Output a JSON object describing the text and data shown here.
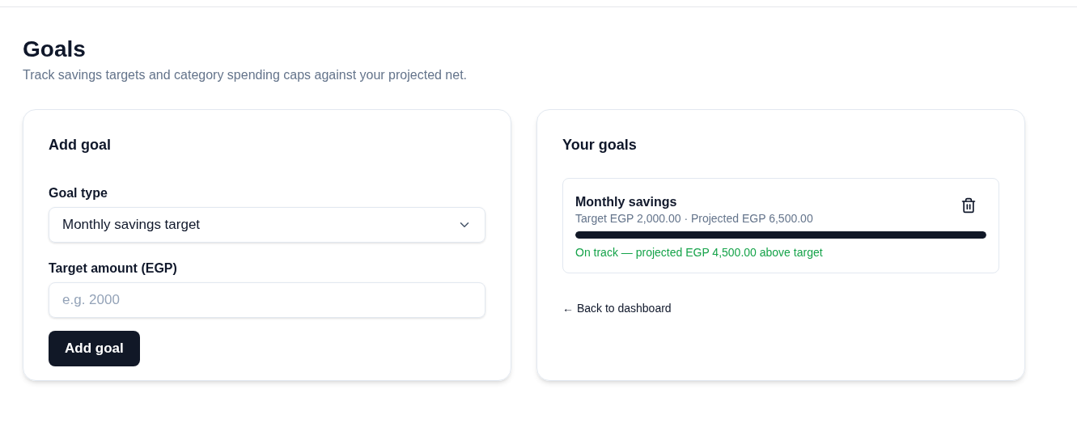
{
  "page": {
    "title": "Goals",
    "subtitle": "Track savings targets and category spending caps against your projected net."
  },
  "add_goal": {
    "title": "Add goal",
    "fields": [
      {
        "kind": "select",
        "label": "Goal type",
        "value": "Monthly savings target"
      },
      {
        "kind": "input",
        "label": "Target amount (EGP)",
        "placeholder": "e.g. 2000"
      }
    ],
    "button": "Add goal"
  },
  "your_goals": {
    "title": "Your goals",
    "goals": [
      {
        "name": "Monthly savings",
        "detail": "Target EGP 2,000.00 · Projected EGP 6,500.00",
        "level": 1,
        "status": "On track — projected EGP 4,500.00 above target",
        "on_track": true
      }
    ],
    "back_link": "← Back to dashboard"
  }
}
